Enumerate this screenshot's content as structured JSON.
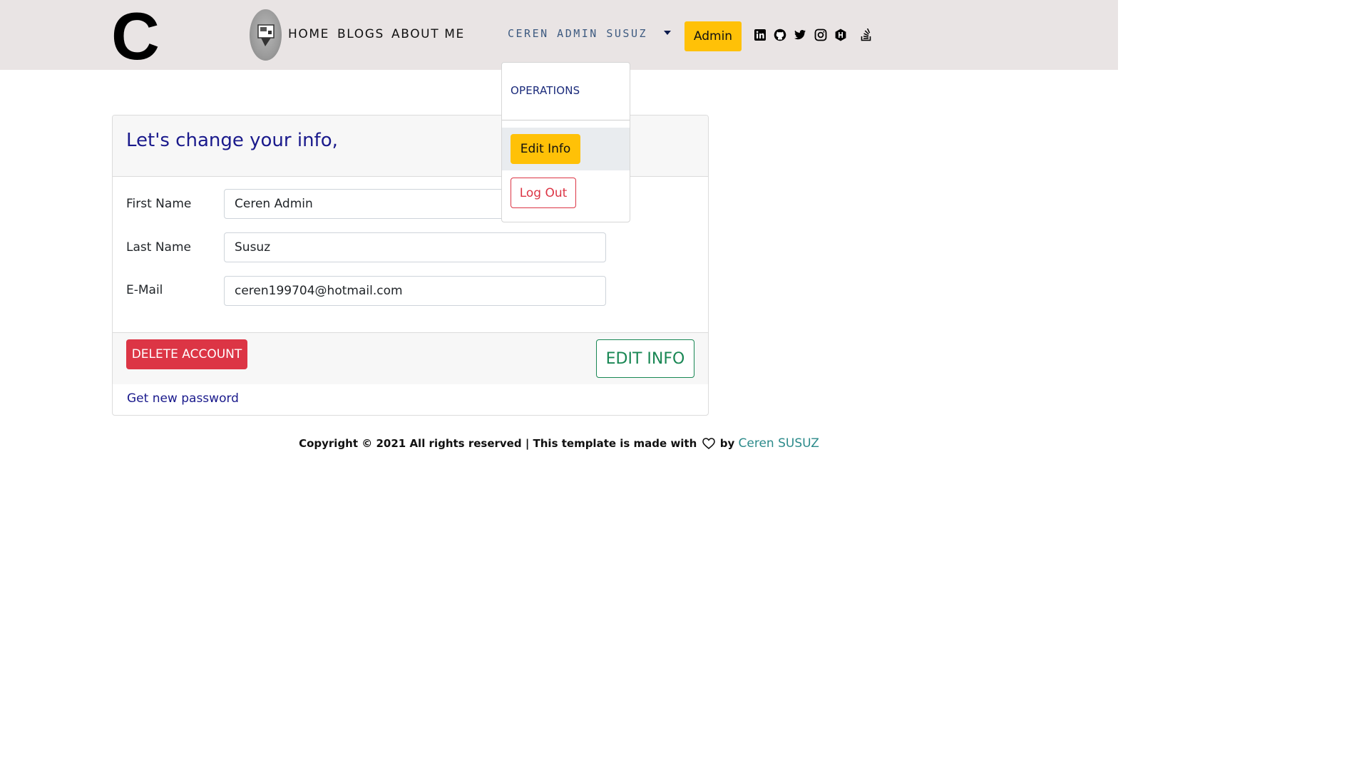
{
  "navbar": {
    "logo": "C",
    "links": [
      {
        "label": "HOME"
      },
      {
        "label": "BLOGS"
      },
      {
        "label": "ABOUT ME"
      }
    ],
    "user_menu": "CEREN ADMIN SUSUZ",
    "admin_button": "Admin",
    "social_icons": [
      "linkedin-icon",
      "github-icon",
      "twitter-icon",
      "instagram-icon",
      "hashnode-icon",
      "stackoverflow-icon"
    ]
  },
  "dropdown": {
    "header": "OPERATIONS",
    "edit_info": "Edit Info",
    "log_out": "Log Out"
  },
  "card": {
    "title": "Let's change your info,",
    "fields": [
      {
        "label": "First Name",
        "value": "Ceren Admin"
      },
      {
        "label": "Last Name",
        "value": "Susuz"
      },
      {
        "label": "E-Mail",
        "value": "ceren199704@hotmail.com"
      }
    ],
    "delete_button": "DELETE ACCOUNT",
    "edit_button": "EDIT INFO",
    "new_password_link": "Get new password"
  },
  "footer": {
    "text_before": "Copyright © 2021 All rights reserved | This template is made with",
    "text_by": "by",
    "author": "Ceren SUSUZ"
  },
  "colors": {
    "navbar_bg": "#e9e4e4",
    "warning": "#ffc107",
    "danger": "#dc3545",
    "success": "#198754",
    "title_blue": "#1a1a8c"
  }
}
